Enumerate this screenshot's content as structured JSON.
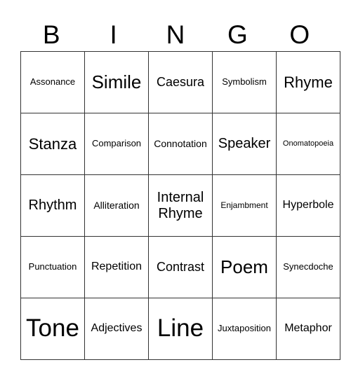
{
  "header": [
    "B",
    "I",
    "N",
    "G",
    "O"
  ],
  "rows": [
    [
      "Assonance",
      "Simile",
      "Caesura",
      "Symbolism",
      "Rhyme"
    ],
    [
      "Stanza",
      "Comparison",
      "Connotation",
      "Speaker",
      "Onomatopoeia"
    ],
    [
      "Rhythm",
      "Alliteration",
      "Internal Rhyme",
      "Enjambment",
      "Hyperbole"
    ],
    [
      "Punctuation",
      "Repetition",
      "Contrast",
      "Poem",
      "Synecdoche"
    ],
    [
      "Tone",
      "Adjectives",
      "Line",
      "Juxtaposition",
      "Metaphor"
    ]
  ]
}
